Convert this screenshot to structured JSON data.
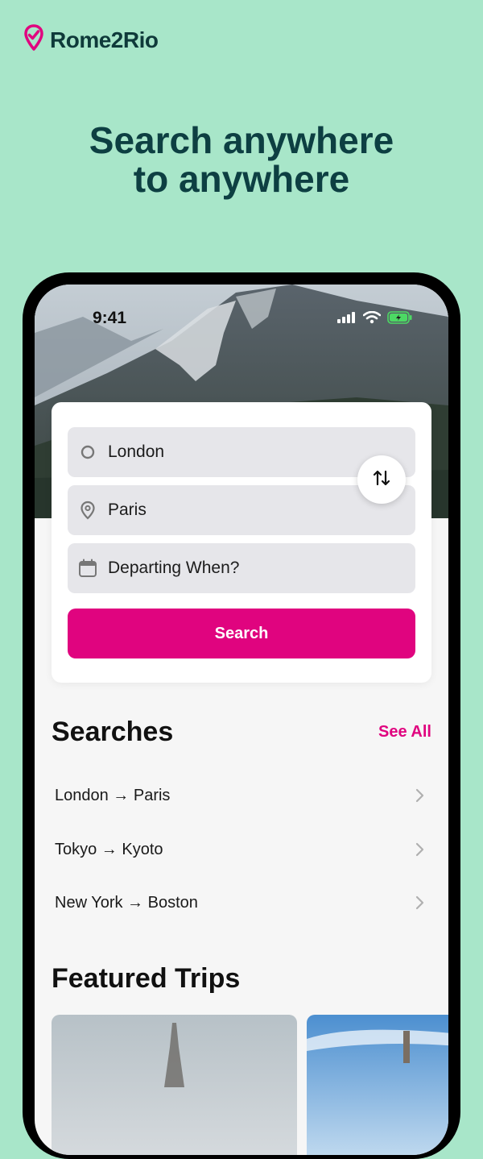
{
  "brand": {
    "name": "Rome2Rio",
    "icon": "pin-check-icon",
    "color": "#e0047f"
  },
  "headline": {
    "line1": "Search anywhere",
    "line2": "to anywhere"
  },
  "status_bar": {
    "time": "9:41",
    "icons": [
      "signal-icon",
      "wifi-icon",
      "battery-icon"
    ]
  },
  "search_form": {
    "from": "London",
    "to": "Paris",
    "date_placeholder": "Departing When?",
    "swap_icon": "swap-arrows-icon",
    "search_label": "Search"
  },
  "searches": {
    "title": "Searches",
    "see_all": "See All",
    "items": [
      {
        "label": "London → Paris"
      },
      {
        "label": "Tokyo → Kyoto"
      },
      {
        "label": "New York → Boston"
      }
    ]
  },
  "featured": {
    "title": "Featured Trips"
  },
  "colors": {
    "background": "#a8e6c9",
    "accent": "#e0047f",
    "headline": "#0d3f42"
  }
}
